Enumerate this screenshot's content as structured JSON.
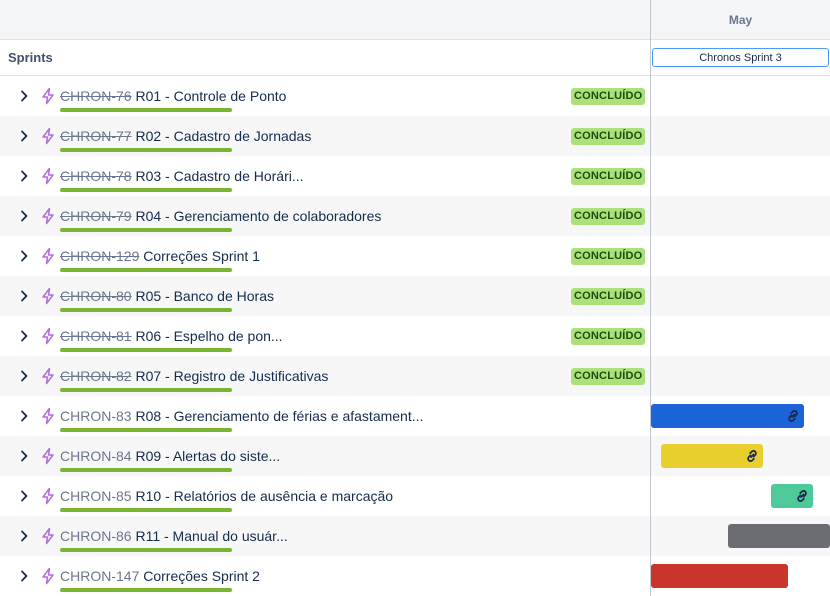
{
  "header": {
    "month": "May"
  },
  "sprints": {
    "title": "Sprints",
    "sprint_chip": "Chronos Sprint 3"
  },
  "rows": [
    {
      "key": "CHRON-76",
      "title": "R01 - Controle de Ponto",
      "done": true,
      "status": "CONCLUÍDO",
      "progress": 1.0
    },
    {
      "key": "CHRON-77",
      "title": "R02 - Cadastro de Jornadas",
      "done": true,
      "status": "CONCLUÍDO",
      "progress": 1.0
    },
    {
      "key": "CHRON-78",
      "title": "R03 - Cadastro de Horári...",
      "done": true,
      "status": "CONCLUÍDO",
      "progress": 1.0
    },
    {
      "key": "CHRON-79",
      "title": "R04 - Gerenciamento de colaboradores",
      "done": true,
      "status": "CONCLUÍDO",
      "progress": 1.0
    },
    {
      "key": "CHRON-129",
      "title": "Correções Sprint 1",
      "done": true,
      "status": "CONCLUÍDO",
      "progress": 1.0
    },
    {
      "key": "CHRON-80",
      "title": "R05 - Banco de Horas",
      "done": true,
      "status": "CONCLUÍDO",
      "progress": 1.0
    },
    {
      "key": "CHRON-81",
      "title": "R06 - Espelho de pon...",
      "done": true,
      "status": "CONCLUÍDO",
      "progress": 1.0
    },
    {
      "key": "CHRON-82",
      "title": "R07 - Registro de Justificativas",
      "done": true,
      "status": "CONCLUÍDO",
      "progress": 1.0
    },
    {
      "key": "CHRON-83",
      "title": "R08 - Gerenciamento de férias e afastament...",
      "done": false,
      "status": "",
      "progress": 1.0
    },
    {
      "key": "CHRON-84",
      "title": "R09 - Alertas do siste...",
      "done": false,
      "status": "",
      "progress": 1.0
    },
    {
      "key": "CHRON-85",
      "title": "R10 - Relatórios de ausência e marcação",
      "done": false,
      "status": "",
      "progress": 1.0
    },
    {
      "key": "CHRON-86",
      "title": "R11 - Manual do usuár...",
      "done": false,
      "status": "",
      "progress": 1.0
    },
    {
      "key": "CHRON-147",
      "title": "Correções Sprint 2",
      "done": false,
      "status": "",
      "progress": 1.0
    }
  ],
  "timeline_bars": [
    null,
    null,
    null,
    null,
    null,
    null,
    null,
    null,
    {
      "color": "#1d63d8",
      "icon": "link-icon"
    },
    {
      "color": "#e9cf2d",
      "icon": "link-icon"
    },
    {
      "color": "#4dc99a",
      "icon": "link-icon"
    },
    {
      "color": "#6b6d73",
      "icon": ""
    },
    {
      "color": "#c9352b",
      "icon": ""
    }
  ],
  "colors": {
    "epic_icon": "#b36be0",
    "progress": "#7ab532",
    "status_bg": "#abe07b",
    "status_text": "#1d4d0c"
  }
}
